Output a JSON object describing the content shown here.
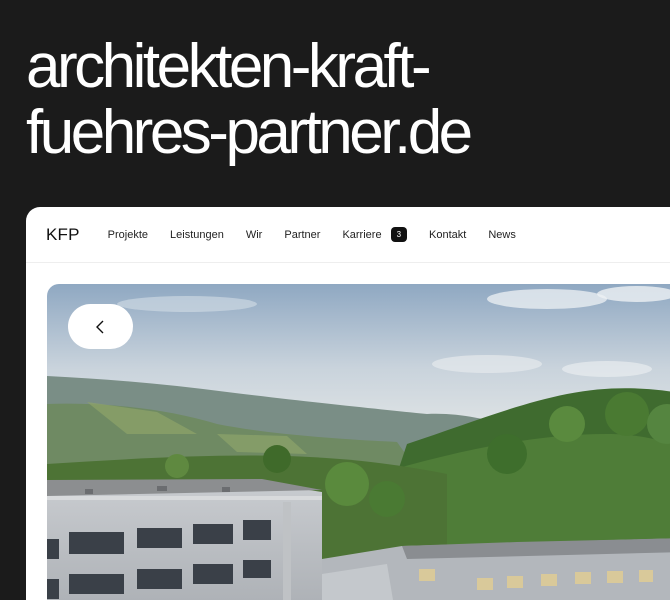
{
  "headline": {
    "line1": "architekten-kraft-",
    "line2": "fuehres-partner.de"
  },
  "site": {
    "logo": "KFP",
    "nav": [
      {
        "label": "Projekte"
      },
      {
        "label": "Leistungen"
      },
      {
        "label": "Wir"
      },
      {
        "label": "Partner"
      },
      {
        "label": "Karriere",
        "badge": "3"
      },
      {
        "label": "Kontakt"
      },
      {
        "label": "News"
      }
    ]
  },
  "hero": {
    "image_icon": "landscape-photo",
    "back_icon": "chevron-left-icon"
  },
  "colors": {
    "background": "#1b1b1b",
    "headline": "#ffffff",
    "badge": "#111111"
  }
}
